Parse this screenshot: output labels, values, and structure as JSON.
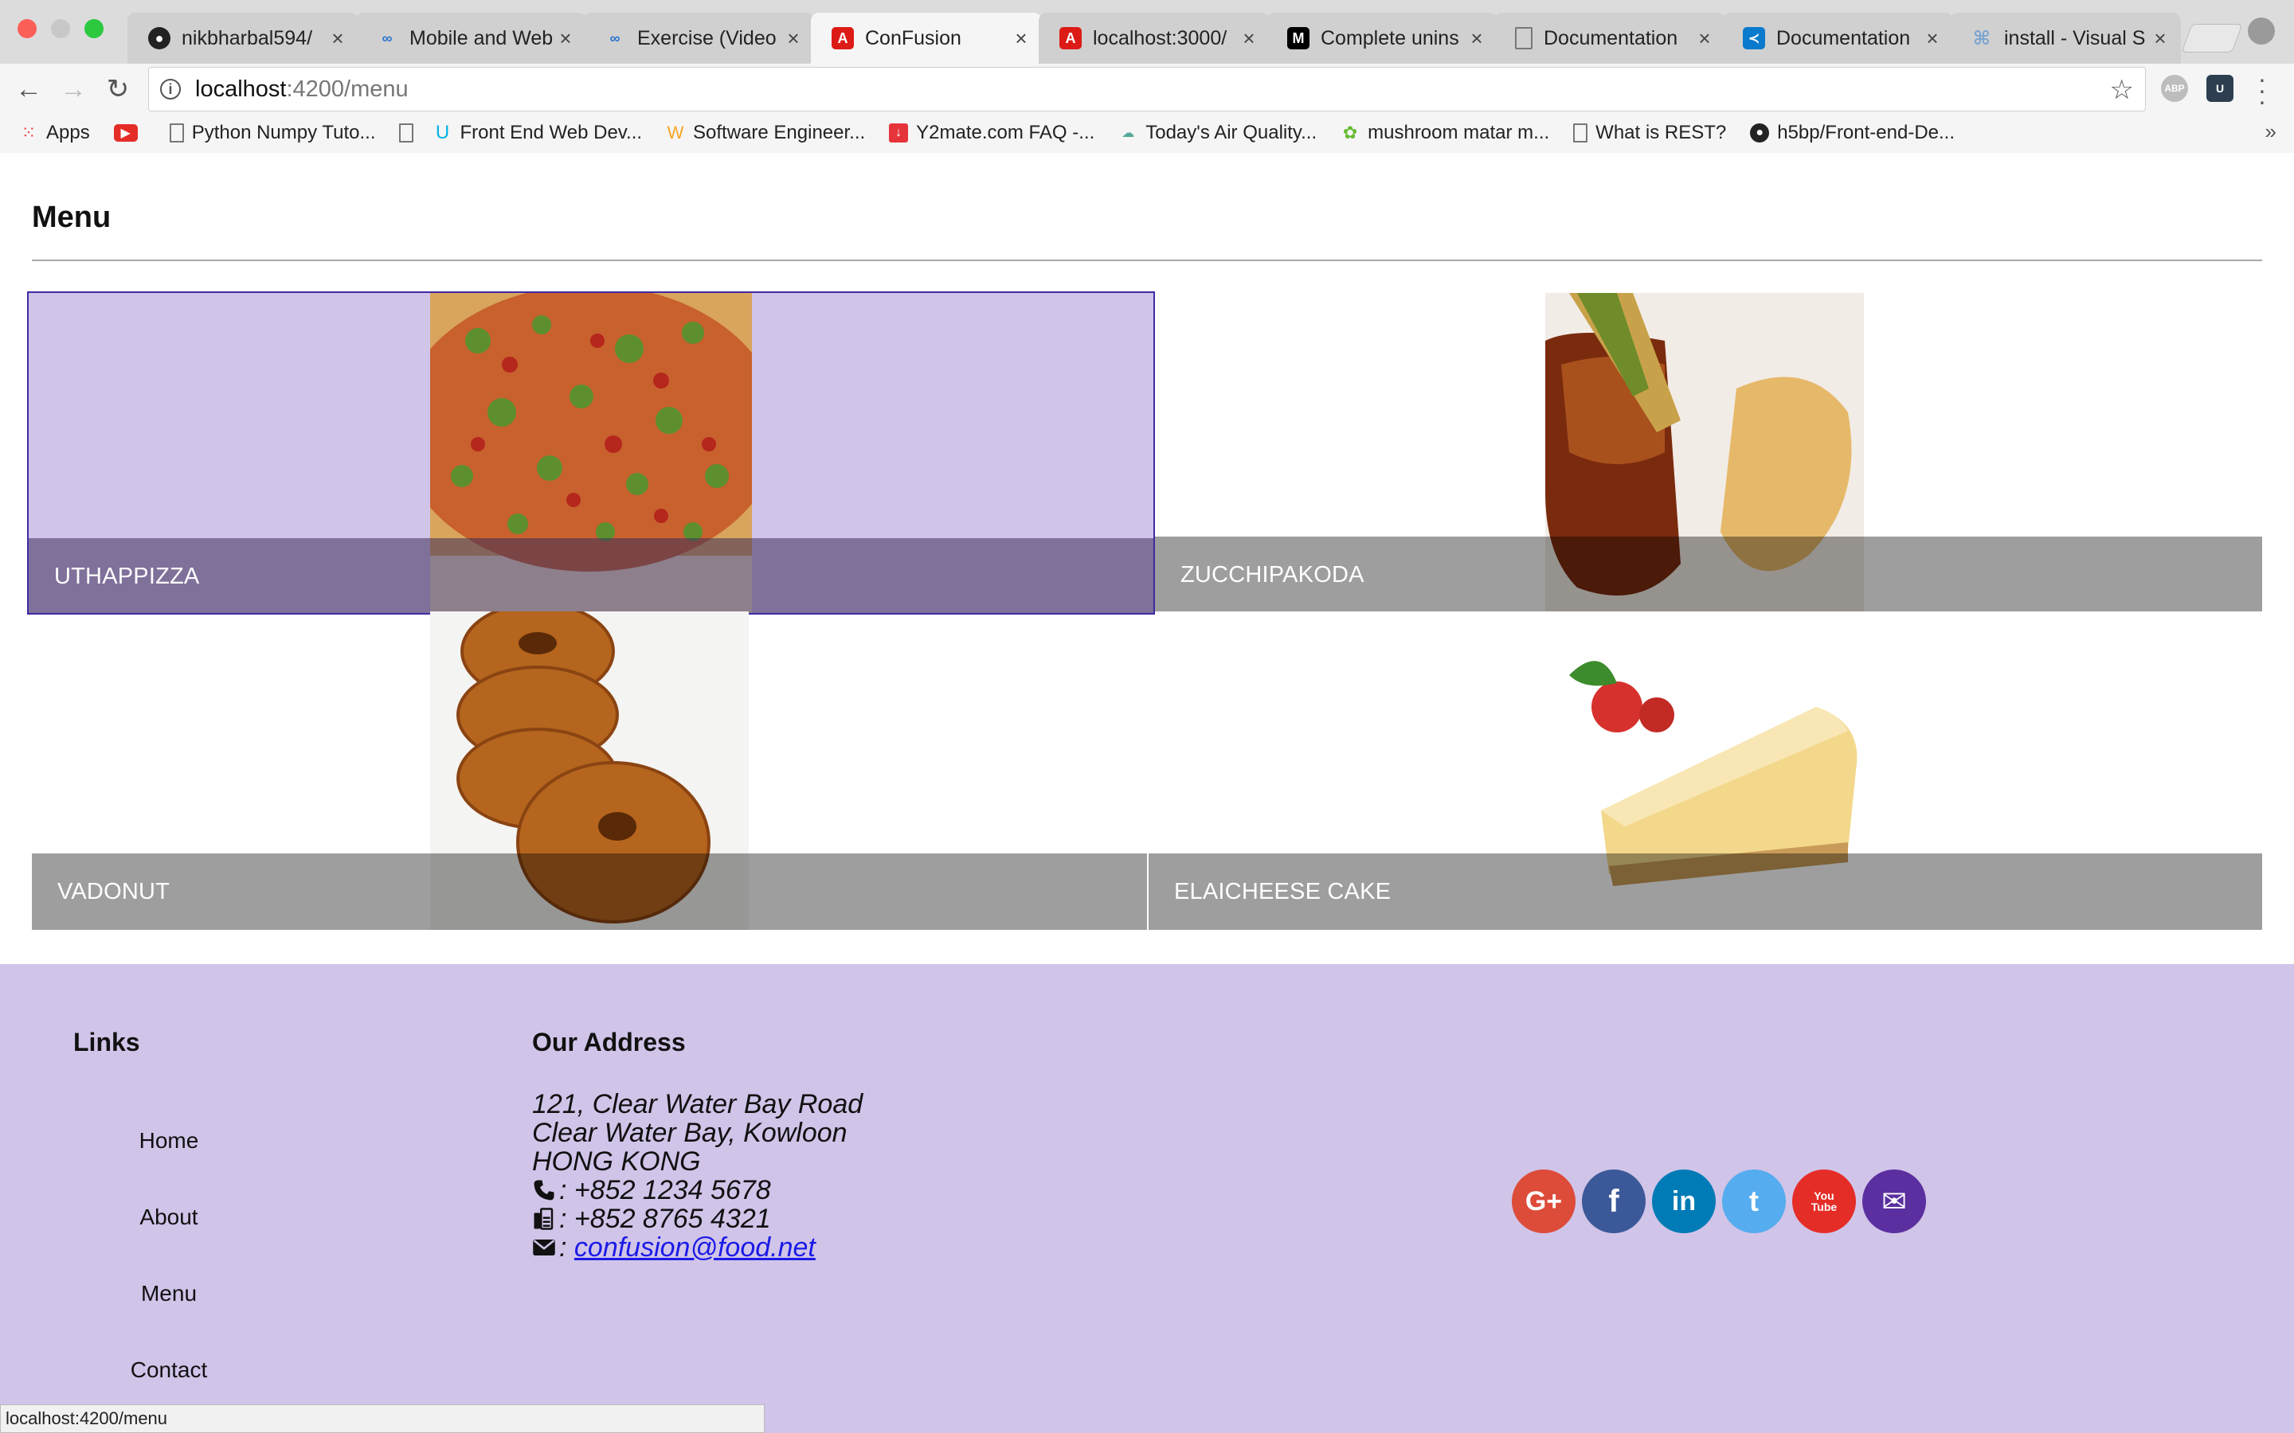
{
  "browser": {
    "tabs": [
      {
        "label": "nikbharbal594/",
        "icon": "github-icon",
        "color": "#222222"
      },
      {
        "label": "Mobile and Web",
        "icon": "coursera-icon",
        "color": "#2a73cc"
      },
      {
        "label": "Exercise (Video",
        "icon": "coursera-icon",
        "color": "#2a73cc"
      },
      {
        "label": "ConFusion",
        "icon": "angular-icon",
        "color": "#dd1b16"
      },
      {
        "label": "localhost:3000/",
        "icon": "angular-icon",
        "color": "#dd1b16"
      },
      {
        "label": "Complete unins",
        "icon": "medium-icon",
        "color": "#000000"
      },
      {
        "label": "Documentation",
        "icon": "page-icon",
        "color": "#ffffff"
      },
      {
        "label": "Documentation",
        "icon": "vscode-icon",
        "color": "#0a7acc"
      },
      {
        "label": "install - Visual S",
        "icon": "command-icon",
        "color": "#7ba6d1"
      }
    ],
    "active_tab_index": 3,
    "url_host": "localhost",
    "url_path": ":4200/menu",
    "extensions": [
      "ABP",
      "U"
    ],
    "bookmarks": [
      {
        "label": "Apps",
        "icon": "apps-grid-icon"
      },
      {
        "label": "",
        "icon": "youtube-icon"
      },
      {
        "label": "Python Numpy Tuto...",
        "icon": "page-icon"
      },
      {
        "label": "",
        "icon": "page-icon"
      },
      {
        "label": "Front End Web Dev...",
        "icon": "udacity-icon"
      },
      {
        "label": "Software Engineer...",
        "icon": "wordpress-icon"
      },
      {
        "label": "Y2mate.com FAQ -...",
        "icon": "download-icon"
      },
      {
        "label": "Today's Air Quality...",
        "icon": "aqi-icon"
      },
      {
        "label": "mushroom matar m...",
        "icon": "leaf-icon"
      },
      {
        "label": "What is REST?",
        "icon": "page-icon"
      },
      {
        "label": "h5bp/Front-end-De...",
        "icon": "github-icon"
      }
    ],
    "status_url": "localhost:4200/menu"
  },
  "page": {
    "title": "Menu",
    "dishes": [
      {
        "name": "UTHAPPIZZA",
        "image": "pizza-image",
        "hovered": true
      },
      {
        "name": "ZUCCHIPAKODA",
        "image": "pakoda-image",
        "hovered": false
      },
      {
        "name": "VADONUT",
        "image": "vadonut-image",
        "hovered": false
      },
      {
        "name": "ELAICHEESE CAKE",
        "image": "cheesecake-image",
        "hovered": false
      }
    ]
  },
  "footer": {
    "links_title": "Links",
    "links": [
      "Home",
      "About",
      "Menu",
      "Contact"
    ],
    "address_title": "Our Address",
    "address_lines": [
      "121, Clear Water Bay Road",
      "Clear Water Bay, Kowloon",
      "HONG KONG"
    ],
    "phone": ": +852 1234 5678",
    "fax": ": +852 8765 4321",
    "email_prefix": ": ",
    "email": "confusion@food.net",
    "social": [
      {
        "name": "google-plus-icon",
        "glyph": "G+",
        "color": "#dd4b39"
      },
      {
        "name": "facebook-icon",
        "glyph": "f",
        "color": "#3b5998"
      },
      {
        "name": "linkedin-icon",
        "glyph": "in",
        "color": "#007bb6"
      },
      {
        "name": "twitter-icon",
        "glyph": "t",
        "color": "#55acee"
      },
      {
        "name": "youtube-icon",
        "glyph": "You Tube",
        "color": "#e52d27"
      },
      {
        "name": "mail-icon",
        "glyph": "✉",
        "color": "#5b2f9f"
      }
    ]
  },
  "colors": {
    "footer_bg": "#d1c4e9",
    "hover_border": "#3f2aa3",
    "link": "#1a1ae6"
  }
}
